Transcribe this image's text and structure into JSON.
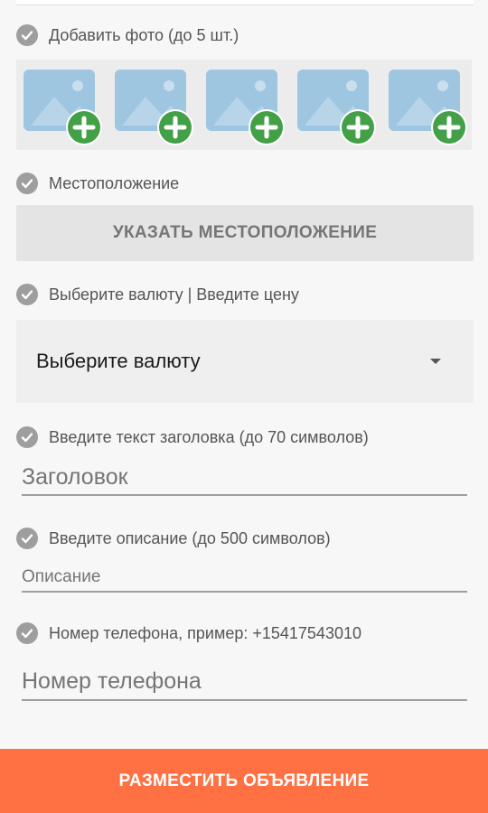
{
  "photos": {
    "label": "Добавить фото (до 5 шт.)",
    "slots": [
      "photo-slot-1",
      "photo-slot-2",
      "photo-slot-3",
      "photo-slot-4",
      "photo-slot-5"
    ]
  },
  "location": {
    "label": "Местоположение",
    "button_label": "УКАЗАТЬ МЕСТОПОЛОЖЕНИЕ"
  },
  "currency": {
    "label": "Выберите валюту | Введите цену",
    "selected": "Выберите валюту"
  },
  "title": {
    "label": "Введите текст заголовка (до 70 символов)",
    "placeholder": "Заголовок"
  },
  "description": {
    "label": "Введите описание (до 500 символов)",
    "placeholder": "Описание"
  },
  "phone": {
    "label": "Номер телефона, пример: +15417543010",
    "placeholder": "Номер телефона"
  },
  "submit_label": "РАЗМЕСТИТЬ ОБЪЯВЛЕНИЕ",
  "colors": {
    "accent": "#ff7043",
    "add_icon": "#43a047",
    "check_icon": "#9e9e9e",
    "photo_placeholder": "#9fc6e0"
  }
}
